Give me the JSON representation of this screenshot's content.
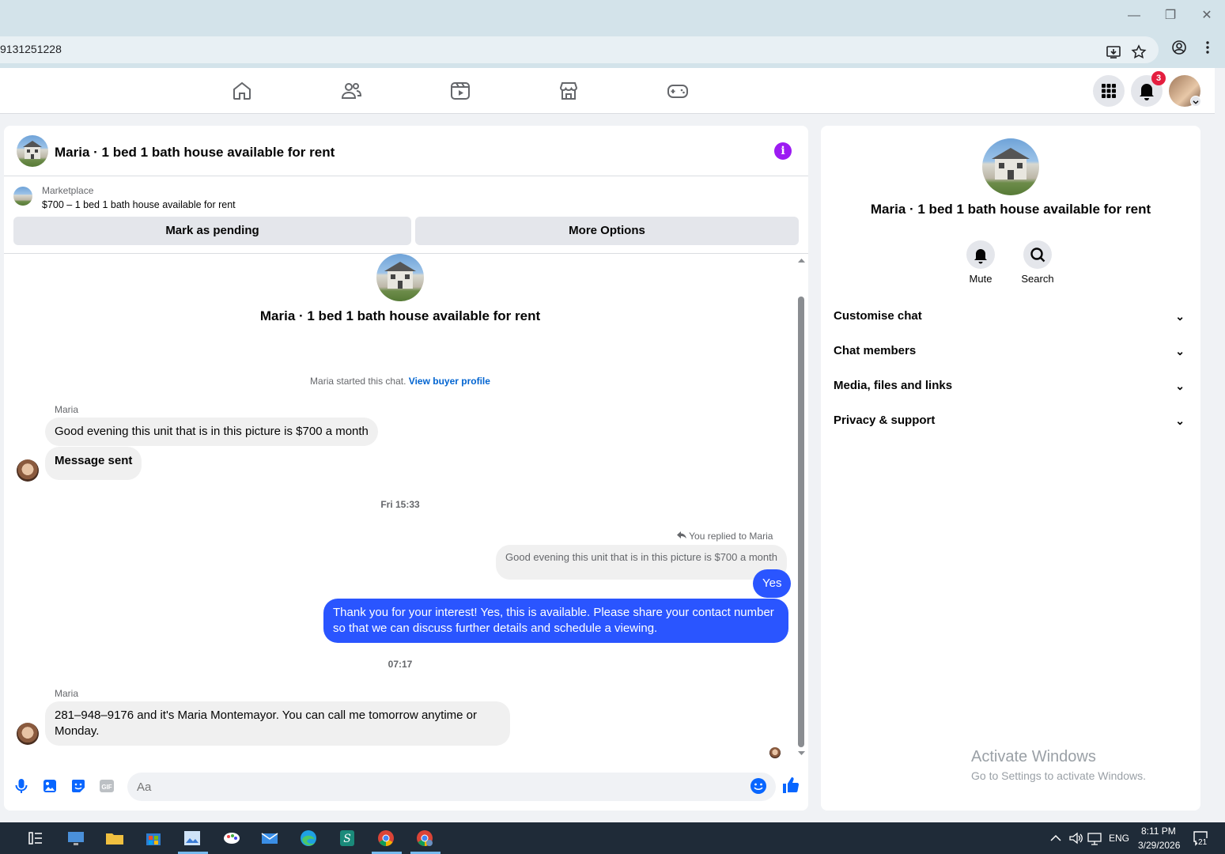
{
  "browser": {
    "url": "9131251228",
    "window_controls": {
      "minimize": "—",
      "restore": "❐",
      "close": "✕"
    }
  },
  "fb_nav": {
    "tabs": [
      "home-icon",
      "friends-icon",
      "video-icon",
      "marketplace-icon",
      "gaming-icon"
    ],
    "notifications_count": "3"
  },
  "chat": {
    "title": "Maria · 1 bed 1 bath house available for rent",
    "marketplace_label": "Marketplace",
    "listing_title": "$700 – 1 bed 1 bath house available for rent",
    "mark_pending_label": "Mark as pending",
    "more_options_label": "More Options",
    "intro_title": "Maria · 1 bed 1 bath house available for rent",
    "started_text": "Maria started this chat.",
    "buyer_profile_link": "View buyer profile",
    "messages": {
      "sender1": "Maria",
      "msg1": "Good evening this unit that is in this picture is $700 a month",
      "msg2": "Message sent",
      "time1": "Fri 15:33",
      "replied_text": "You replied to Maria",
      "quoted": "Good evening this unit that is in this picture is $700 a month",
      "out1": "Yes",
      "out2": "Thank you for your interest! Yes, this is available. Please share your contact number so that we can discuss further details and schedule a viewing.",
      "time2": "07:17",
      "sender2": "Maria",
      "msg3": "281–948–9176 and it's Maria Montemayor. You can call me tomorrow anytime or Monday."
    },
    "composer_placeholder": "Aa"
  },
  "info_panel": {
    "title": "Maria · 1 bed 1 bath house available for rent",
    "mute_label": "Mute",
    "search_label": "Search",
    "rows": [
      "Customise chat",
      "Chat members",
      "Media, files and links",
      "Privacy & support"
    ]
  },
  "watermark": {
    "line1": "Activate Windows",
    "line2": "Go to Settings to activate Windows."
  },
  "taskbar": {
    "lang": "ENG",
    "time": "8:11 PM",
    "date": "3/29/2026",
    "notif_count": "21"
  },
  "colors": {
    "accent_blue": "#2a55ff",
    "info_purple": "#9c1bf2",
    "badge_red": "#e41e3f"
  }
}
